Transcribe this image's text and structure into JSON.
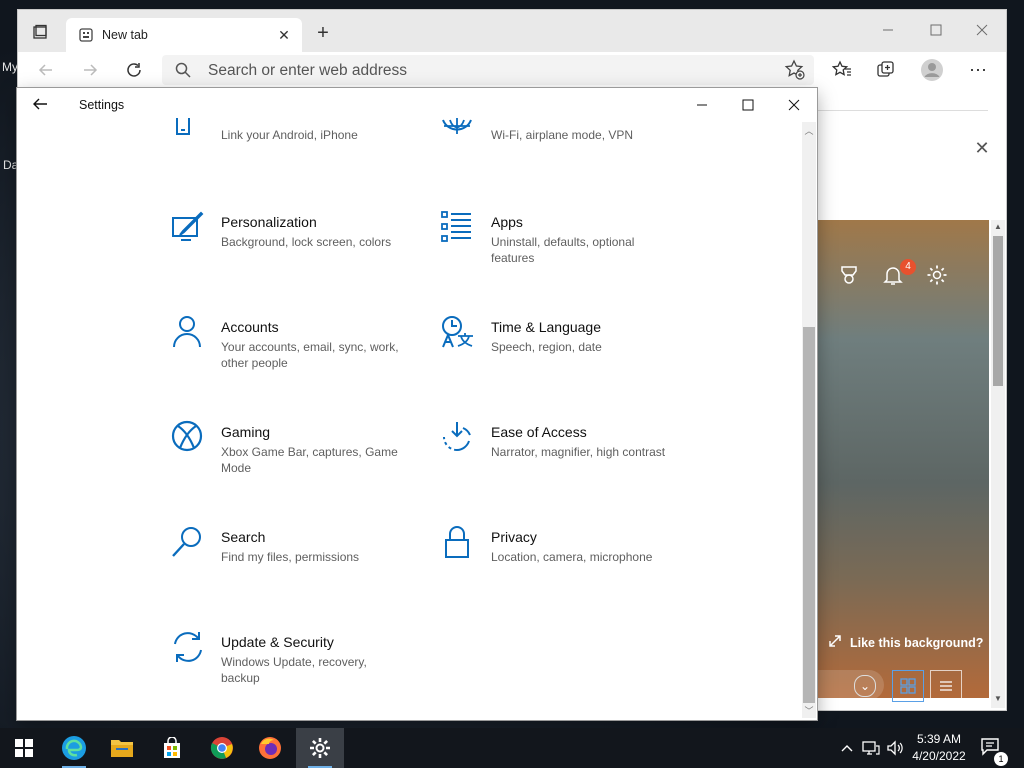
{
  "desktop": {
    "label_top": "My",
    "label_mid": "Da"
  },
  "browser": {
    "tab_title": "New tab",
    "address_placeholder": "Search or enter web address",
    "background_prompt": "Like this background?",
    "notification_count": "4"
  },
  "settings": {
    "title": "Settings",
    "items": [
      {
        "name": "",
        "desc": "Link your Android, iPhone",
        "icon": "phone-icon"
      },
      {
        "name": "",
        "desc": "Wi-Fi, airplane mode, VPN",
        "icon": "globe-icon"
      },
      {
        "name": "Personalization",
        "desc": "Background, lock screen, colors",
        "icon": "personalization-icon"
      },
      {
        "name": "Apps",
        "desc": "Uninstall, defaults, optional features",
        "icon": "apps-icon"
      },
      {
        "name": "Accounts",
        "desc": "Your accounts, email, sync, work, other people",
        "icon": "accounts-icon"
      },
      {
        "name": "Time & Language",
        "desc": "Speech, region, date",
        "icon": "time-language-icon"
      },
      {
        "name": "Gaming",
        "desc": "Xbox Game Bar, captures, Game Mode",
        "icon": "xbox-icon"
      },
      {
        "name": "Ease of Access",
        "desc": "Narrator, magnifier, high contrast",
        "icon": "ease-of-access-icon"
      },
      {
        "name": "Search",
        "desc": "Find my files, permissions",
        "icon": "search-icon"
      },
      {
        "name": "Privacy",
        "desc": "Location, camera, microphone",
        "icon": "lock-icon"
      },
      {
        "name": "Update & Security",
        "desc": "Windows Update, recovery, backup",
        "icon": "sync-icon"
      }
    ]
  },
  "taskbar": {
    "time": "5:39 AM",
    "date": "4/20/2022",
    "action_center_count": "1"
  },
  "colors": {
    "accent": "#0a6cbd",
    "badge": "#e8512e"
  }
}
